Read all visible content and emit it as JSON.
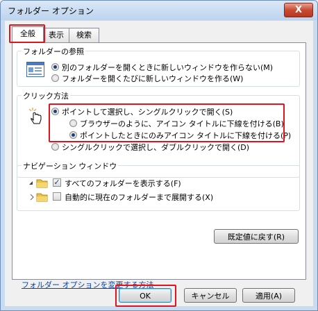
{
  "window": {
    "title": "フォルダー オプション",
    "close_glyph": "X"
  },
  "tabs": [
    {
      "label": "全般",
      "active": true
    },
    {
      "label": "表示",
      "active": false
    },
    {
      "label": "検索",
      "active": false
    }
  ],
  "browse_group": {
    "label": "フォルダーの参照",
    "options": [
      {
        "label": "別のフォルダーを開くときに新しいウィンドウを作らない(M)",
        "selected": true
      },
      {
        "label": "フォルダーを開くたびに新しいウィンドウを作る(W)",
        "selected": false
      }
    ]
  },
  "click_group": {
    "label": "クリック方法",
    "options": [
      {
        "label": "ポイントして選択し、シングルクリックで開く(S)",
        "selected": true
      },
      {
        "label": "ブラウザーのように、アイコン タイトルに下線を付ける(B)",
        "selected": false
      },
      {
        "label": "ポイントしたときにのみアイコン タイトルに下線を付ける(P)",
        "selected": true
      },
      {
        "label": "シングルクリックで選択し、ダブルクリックで開く(D)",
        "selected": false
      }
    ]
  },
  "nav_group": {
    "label": "ナビゲーション ウィンドウ",
    "options": [
      {
        "label": "すべてのフォルダーを表示する(F)",
        "checked": true
      },
      {
        "label": "自動的に現在のフォルダーまで展開する(X)",
        "checked": false
      }
    ]
  },
  "restore_button": "既定値に戻す(R)",
  "help_link": "フォルダー オプションを変更する方法",
  "footer": {
    "ok": "OK",
    "cancel": "キャンセル",
    "apply": "適用(A)"
  }
}
